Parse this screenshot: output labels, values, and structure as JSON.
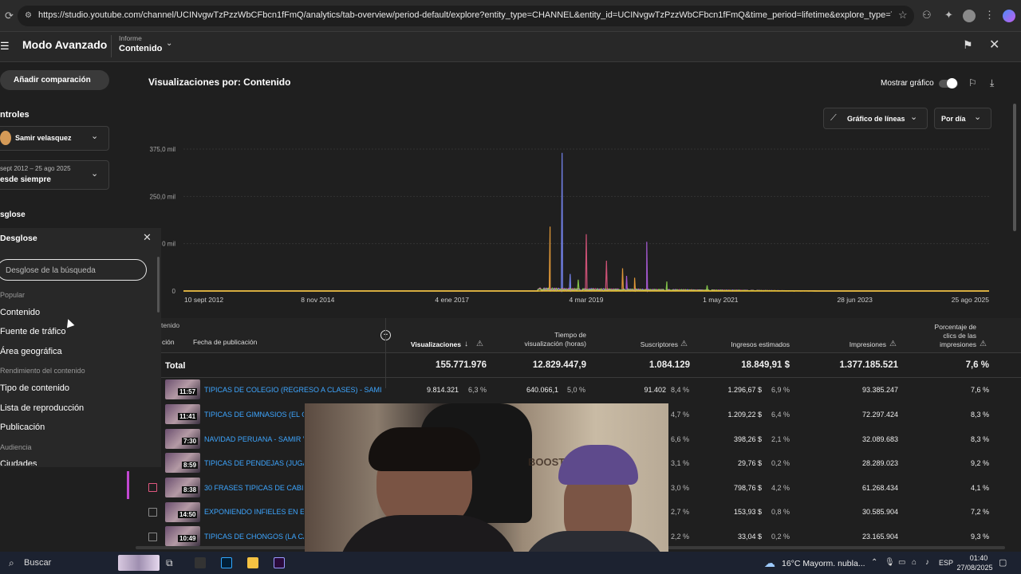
{
  "browser": {
    "url": "https://studio.youtube.com/channel/UCINvgwTzPzzWbCFbcn1fFmQ/analytics/tab-overview/period-default/explore?entity_type=CHANNEL&entity_id=UCINvgwTzPzzWbCFbcn1fFmQ&time_period=lifetime&explore_type=TABLE_AND_CHART&metrics_co..."
  },
  "header": {
    "title": "Modo Avanzado",
    "report_caption": "Informe",
    "report_value": "Contenido"
  },
  "sidebar": {
    "compare_button": "Añadir comparación",
    "controls_heading": "ntroles",
    "channel_name": "Samir velasquez",
    "date_range": "sept 2012 – 25 ago 2025",
    "date_preset": "esde siempre",
    "breakdown_heading": "sglose",
    "breakdown_panel_title": "Desglose",
    "search_placeholder": "Desglose de la búsqueda",
    "groups": [
      {
        "title": "Popular",
        "items": [
          "Contenido",
          "Fuente de tráfico",
          "Área geográfica"
        ]
      },
      {
        "title": "Rendimiento del contenido",
        "items": [
          "Tipo de contenido",
          "Lista de reproducción",
          "Publicación"
        ]
      },
      {
        "title": "Audiencia",
        "items": [
          "Ciudades"
        ]
      }
    ]
  },
  "chart_header": {
    "title": "Visualizaciones por: Contenido",
    "toggle_label": "Mostrar gráfico",
    "chart_type": "Gráfico de líneas",
    "granularity": "Por día"
  },
  "chart_data": {
    "type": "line",
    "ylim": [
      0,
      375000
    ],
    "y_ticks": [
      "375,0 mil",
      "250,0 mil",
      "0 mil",
      "0"
    ],
    "x_ticks": [
      "10 sept 2012",
      "8 nov 2014",
      "4 ene 2017",
      "4 mar 2019",
      "1 may 2021",
      "28 jun 2023",
      "25 ago 2025"
    ],
    "series": [
      {
        "color": "#f2a33a",
        "spikes": [
          [
            0.455,
            170000
          ],
          [
            0.545,
            60000
          ],
          [
            0.56,
            35000
          ]
        ]
      },
      {
        "color": "#7b8cff",
        "spikes": [
          [
            0.47,
            365000
          ],
          [
            0.48,
            45000
          ]
        ]
      },
      {
        "color": "#e0577f",
        "spikes": [
          [
            0.5,
            150000
          ],
          [
            0.525,
            80000
          ]
        ]
      },
      {
        "color": "#b15ee3",
        "spikes": [
          [
            0.575,
            130000
          ],
          [
            0.55,
            40000
          ]
        ]
      },
      {
        "color": "#8cd14d",
        "spikes": [
          [
            0.49,
            30000
          ],
          [
            0.6,
            25000
          ],
          [
            0.65,
            15000
          ]
        ]
      }
    ]
  },
  "table": {
    "col_content_partial": "ción",
    "col_pub_date": "Fecha de publicación",
    "group_label": "tenido",
    "columns": [
      "Visualizaciones",
      "Tiempo de visualización (horas)",
      "Suscriptores",
      "Ingresos estimados",
      "Impresiones",
      "Porcentaje de clics de las impresiones"
    ],
    "total_label": "Total",
    "totals": [
      "155.771.976",
      "12.829.447,9",
      "1.084.129",
      "18.849,91 $",
      "1.377.185.521",
      "7,6 %"
    ],
    "rows": [
      {
        "dur": "11:57",
        "title": "TIPICAS DE COLEGIO (REGRESO A CLASES) - SAMIR V...",
        "views": "9.814.321",
        "views_pct": "6,3 %",
        "watch": "640.066,1",
        "watch_pct": "5,0 %",
        "subs": "91.402",
        "subs_pct": "8,4 %",
        "rev": "1.296,67 $",
        "rev_pct": "6,9 %",
        "impr": "93.385.247",
        "ctr": "7,6 %"
      },
      {
        "dur": "11:41",
        "title": "TIPICAS DE GIMNASIOS (EL GY",
        "subs_pct": "4,7 %",
        "rev": "1.209,22 $",
        "rev_pct": "6,4 %",
        "impr": "72.297.424",
        "ctr": "8,3 %"
      },
      {
        "dur": "7:30",
        "title": "NAVIDAD PERUANA - SAMIR VE",
        "subs_pct": "6,6 %",
        "rev": "398,26 $",
        "rev_pct": "2,1 %",
        "impr": "32.089.683",
        "ctr": "8,3 %"
      },
      {
        "dur": "8:59",
        "title": "TIPICAS DE PENDEJAS (JUGAD",
        "subs_pct": "3,1 %",
        "rev": "29,76 $",
        "rev_pct": "0,2 %",
        "impr": "28.289.023",
        "ctr": "9,2 %"
      },
      {
        "dur": "8:38",
        "title": "30 FRASES TIPICAS DE CABINA",
        "subs_pct": "3,0 %",
        "rev": "798,76 $",
        "rev_pct": "4,2 %",
        "impr": "61.268.434",
        "ctr": "4,1 %"
      },
      {
        "dur": "14:50",
        "title": "EXPONIENDO INFIELES EN EL P",
        "subs_pct": "2,7 %",
        "rev": "153,93 $",
        "rev_pct": "0,8 %",
        "impr": "30.585.904",
        "ctr": "7,2 %"
      },
      {
        "dur": "10:49",
        "title": "TIPICAS DE CHONGOS (LA CAS",
        "subs_pct": "2,2 %",
        "rev": "33,04 $",
        "rev_pct": "0,2 %",
        "impr": "23.165.904",
        "ctr": "9,3 %"
      }
    ]
  },
  "overlay": {
    "wall_text": "BOOST"
  },
  "taskbar": {
    "search": "Buscar",
    "weather": "16°C  Mayorm. nubla...",
    "lang": "ESP",
    "time": "01:40",
    "date": "27/08/2025"
  }
}
